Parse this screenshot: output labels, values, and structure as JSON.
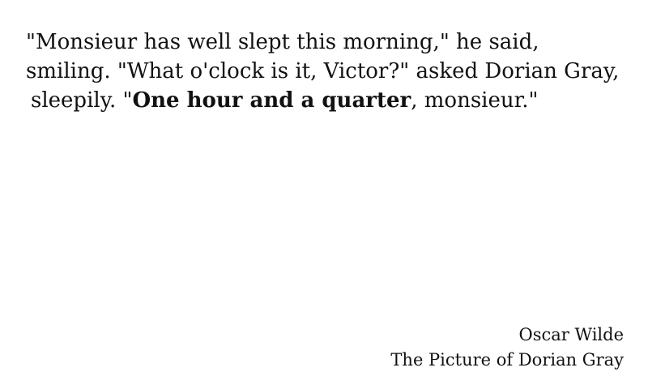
{
  "quote": {
    "line1": "\"Monsieur has well slept this morning,\" he said,",
    "line2": "smiling. \"What o'clock is it, Victor?\" asked Dorian Gray,",
    "line3_before": "sleepily. \"",
    "line3_bold": "One hour and a quarter",
    "line3_after": ", monsieur.\""
  },
  "attribution": {
    "author": "Oscar Wilde",
    "work": "The Picture of Dorian Gray"
  }
}
